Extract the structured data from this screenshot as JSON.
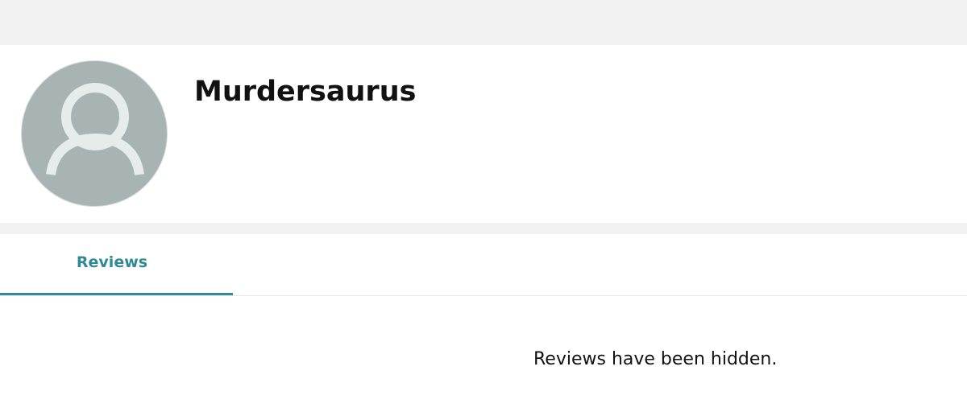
{
  "profile": {
    "name": "Murdersaurus",
    "avatar_icon": "default-user-silhouette-icon"
  },
  "tabs": [
    {
      "label": "Reviews",
      "active": true
    }
  ],
  "reviews": {
    "empty_message": "Reviews have been hidden."
  },
  "colors": {
    "accent": "#2f8a96",
    "avatar_bg": "#a8b4b4",
    "page_band": "#f2f2f2",
    "text": "#111111"
  }
}
